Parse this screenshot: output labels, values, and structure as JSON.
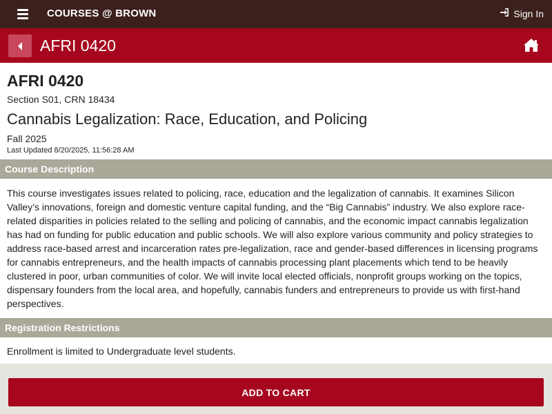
{
  "topbar": {
    "brand": "COURSES @ BROWN",
    "signin_label": "Sign In",
    "menu_icon": "hamburger-menu-icon",
    "signin_icon": "sign-in-icon",
    "background_color": "#3b201c"
  },
  "course_bar": {
    "title": "AFRI 0420",
    "back_icon": "caret-left-icon",
    "home_icon": "home-icon",
    "background_color": "#a7071e"
  },
  "course": {
    "code": "AFRI 0420",
    "section": "Section S01, CRN 18434",
    "title": "Cannabis Legalization: Race, Education, and Policing",
    "term": "Fall 2025",
    "last_updated": "Last Updated 8/20/2025, 11:56:28 AM"
  },
  "description": {
    "heading": "Course Description",
    "text": "This course investigates issues related to policing, race, education and the legalization of cannabis. It examines Silicon Valley’s innovations, foreign and domestic venture capital funding, and the “Big Cannabis” industry. We also explore race-related disparities in policies related to the selling and policing of cannabis, and the economic impact cannabis legalization has had on funding for public education and public schools. We will also explore various community and policy strategies to address race-based arrest and incarceration rates pre-legalization, race and gender-based differences in licensing programs for cannabis entrepreneurs, and the health impacts of cannabis processing plant placements which tend to be heavily clustered in poor, urban communities of color. We will invite local elected officials, nonprofit groups working on the topics, dispensary founders from the local area, and hopefully, cannabis funders and entrepreneurs to provide us with first-hand perspectives."
  },
  "restrictions": {
    "heading": "Registration Restrictions",
    "text": "Enrollment is limited to Undergraduate level students."
  },
  "footer": {
    "add_to_cart_label": "ADD TO CART"
  }
}
